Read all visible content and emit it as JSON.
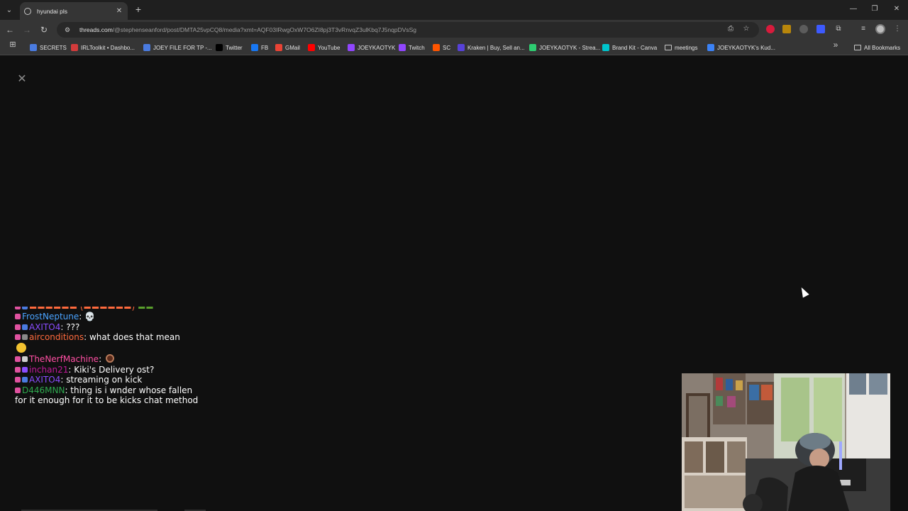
{
  "browser": {
    "tab": {
      "title": "hyundai pls"
    },
    "url": {
      "host": "threads.com",
      "path": "/@stephenseanford/post/DMTA25vpCQ8/media?xmt=AQF03IRwgOxW7O6ZI8pj3T3vRnvqZ3ulKbq7J5nqpDVsSg"
    },
    "bookmarks": [
      {
        "label": "SECRETS",
        "icon_color": "#4a7be0"
      },
      {
        "label": "IRLToolkit • Dashbo...",
        "icon_color": "#d23b3b"
      },
      {
        "label": "JOEY FILE FOR TP -...",
        "icon_color": "#4a7be0"
      },
      {
        "label": "Twitter",
        "icon_color": "#000000"
      },
      {
        "label": "FB",
        "icon_color": "#1877f2"
      },
      {
        "label": "GMail",
        "icon_color": "#ea4335"
      },
      {
        "label": "YouTube",
        "icon_color": "#ff0000"
      },
      {
        "label": "JOEYKAOTYK",
        "icon_color": "#9146ff"
      },
      {
        "label": "Twitch",
        "icon_color": "#9146ff"
      },
      {
        "label": "SC",
        "icon_color": "#ff5500"
      },
      {
        "label": "Kraken | Buy, Sell an...",
        "icon_color": "#5741d9"
      },
      {
        "label": "JOEYKAOTYK - Strea...",
        "icon_color": "#2ecc71"
      },
      {
        "label": "Brand Kit - Canva",
        "icon_color": "#00c4cc"
      },
      {
        "label": "meetings",
        "icon_color": ""
      },
      {
        "label": "JOEYKAOTYK's Kud...",
        "icon_color": "#3b82f6"
      }
    ],
    "all_bookmarks_label": "All Bookmarks"
  },
  "chat": {
    "messages": [
      {
        "user": "FrostNeptune",
        "color": "#4aa3ff",
        "text": ": 💀"
      },
      {
        "user": "AXITO4",
        "color": "#8a4dff",
        "text": ": ???"
      },
      {
        "user": "airconditions",
        "color": "#ff6a3d",
        "text": ": what does that mean"
      },
      {
        "user": "TheNerfMachine",
        "color": "#ff4fa3",
        "text": ": "
      },
      {
        "user": "inchan21",
        "color": "#c0199a",
        "text": ": Kiki's Delivery ost?"
      },
      {
        "user": "AXITO4",
        "color": "#8a4dff",
        "text": ": streaming on kick"
      },
      {
        "user": "D446MNN",
        "color": "#2fa84f",
        "text": ": thing is i wnder whose fallen for it enough for it to be kicks chat method"
      }
    ]
  }
}
